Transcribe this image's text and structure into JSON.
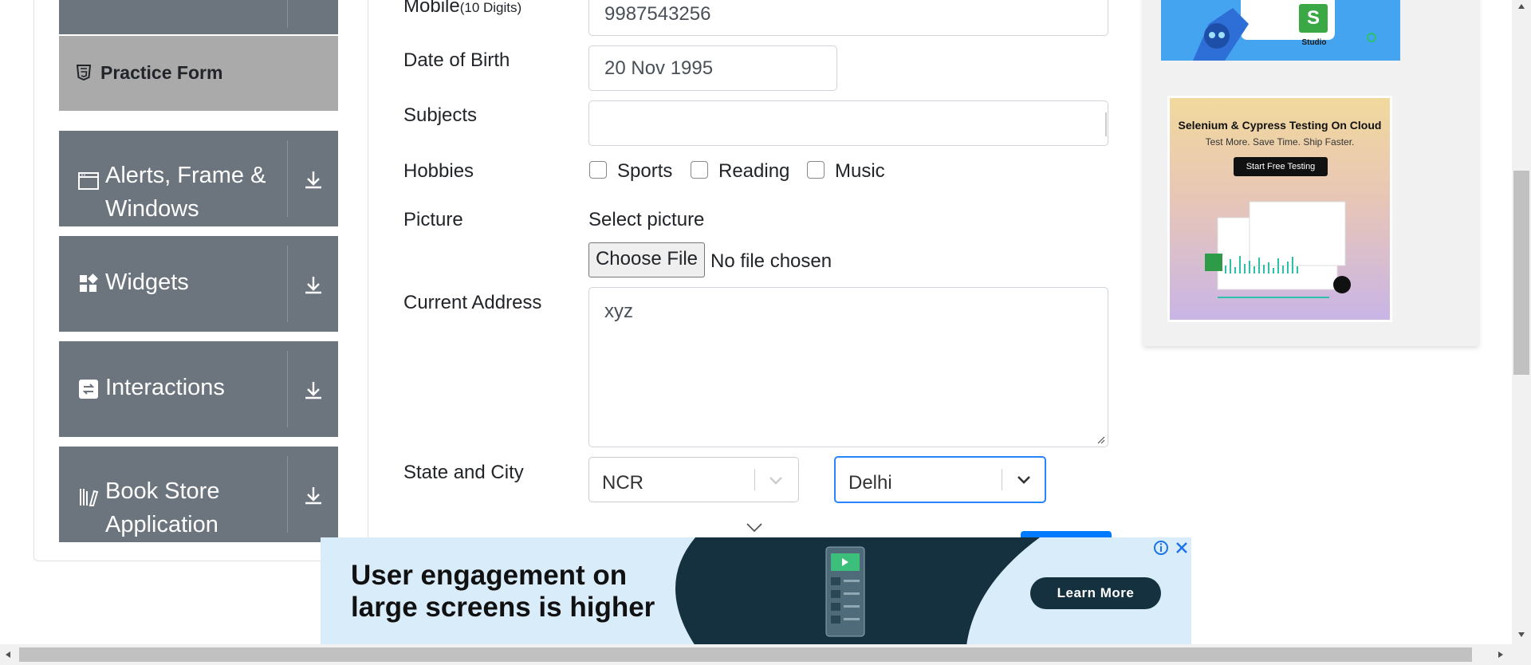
{
  "sidebar": {
    "practice_form": "Practice Form",
    "groups": [
      {
        "label": "Alerts, Frame & Windows",
        "icon": "window-icon"
      },
      {
        "label": "Widgets",
        "icon": "widgets-icon"
      },
      {
        "label": "Interactions",
        "icon": "interactions-icon"
      },
      {
        "label": "Book Store Application",
        "icon": "books-icon"
      }
    ]
  },
  "form": {
    "mobile_label": "Mobile",
    "mobile_hint": "(10 Digits)",
    "mobile_value": "9987543256",
    "dob_label": "Date of Birth",
    "dob_value": "20 Nov 1995",
    "subjects_label": "Subjects",
    "subjects_value": "",
    "hobbies_label": "Hobbies",
    "hobbies": [
      "Sports",
      "Reading",
      "Music"
    ],
    "picture_label": "Picture",
    "select_picture": "Select picture",
    "choose_file": "Choose File",
    "no_file": "No file chosen",
    "address_label": "Current Address",
    "address_value": "xyz",
    "state_city_label": "State and City",
    "state_value": "NCR",
    "city_value": "Delhi"
  },
  "ads": {
    "sk_label": "Studio",
    "selenium_title": "Selenium & Cypress Testing On Cloud",
    "selenium_sub": "Test More. Save Time. Ship Faster.",
    "selenium_button": "Start Free Testing",
    "banner_headline_1": "User engagement on",
    "banner_headline_2": "large screens is higher",
    "banner_button": "Learn More"
  },
  "colors": {
    "sidebar_bg": "#6c757d",
    "practice_bg": "#aaaaaa",
    "focus_border": "#2684ff",
    "banner_bg": "#d9ecfa",
    "banner_dark": "#15303f"
  }
}
